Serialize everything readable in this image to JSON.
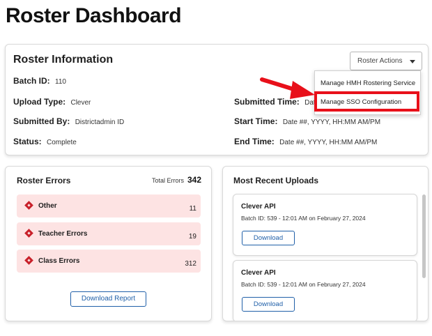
{
  "page": {
    "title": "Roster Dashboard"
  },
  "roster_info": {
    "title": "Roster Information",
    "actions_label": "Roster Actions",
    "batch_id": {
      "label": "Batch ID:",
      "value": "110"
    },
    "upload_type": {
      "label": "Upload Type:",
      "value": "Clever"
    },
    "submitted_by": {
      "label": "Submitted By:",
      "value": "Districtadmin ID"
    },
    "status": {
      "label": "Status:",
      "value": "Complete"
    },
    "submitted_time": {
      "label": "Submitted Time:",
      "value": "Date ##"
    },
    "start_time": {
      "label": "Start Time:",
      "value": "Date ##, YYYY, HH:MM AM/PM"
    },
    "end_time": {
      "label": "End Time:",
      "value": "Date ##, YYYY, HH:MM AM/PM"
    }
  },
  "actions_menu": {
    "items": [
      {
        "label": "Manage HMH Rostering Service"
      },
      {
        "label": "Manage SSO Configuration"
      }
    ],
    "highlight_color": "#e8101a"
  },
  "roster_errors": {
    "title": "Roster Errors",
    "total_label": "Total Errors",
    "total_value": "342",
    "rows": [
      {
        "name": "Other",
        "count": "11"
      },
      {
        "name": "Teacher Errors",
        "count": "19"
      },
      {
        "name": "Class Errors",
        "count": "312"
      }
    ],
    "report_button": "Download Report"
  },
  "recent_uploads": {
    "title": "Most Recent Uploads",
    "items": [
      {
        "name": "Clever API",
        "meta": "Batch ID: 539 - 12:01 AM on February 27, 2024",
        "button": "Download"
      },
      {
        "name": "Clever API",
        "meta": "Batch ID: 539 - 12:01 AM on February 27, 2024",
        "button": "Download"
      }
    ]
  },
  "colors": {
    "accent": "#1f5fa8",
    "error_bg": "#fde3e3",
    "error_icon": "#c8202a"
  }
}
